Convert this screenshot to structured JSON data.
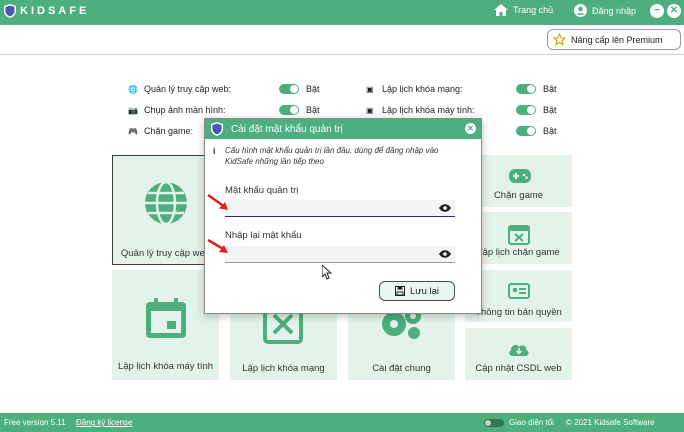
{
  "app": {
    "name": "KIDSAFE"
  },
  "header": {
    "home_label": "Trang chủ",
    "login_label": "Đăng nhập",
    "minimize": "−",
    "close": "✕"
  },
  "upgrade": {
    "label": "Nâng cấp lên Premium"
  },
  "settings_left": [
    {
      "label": "Quản lý truy cập web:",
      "state": "Bật",
      "icon": "globe-icon"
    },
    {
      "label": "Chụp ảnh màn hình:",
      "state": "Bật",
      "icon": "camera-icon"
    },
    {
      "label": "Chặn game:",
      "state": "Bật",
      "icon": "gamepad-icon"
    }
  ],
  "settings_right": [
    {
      "label": "Lập lịch khóa mạng:",
      "state": "Bật",
      "icon": "calendar-x-icon"
    },
    {
      "label": "Lập lịch khóa máy tính:",
      "state": "Bật",
      "icon": "calendar-x-icon"
    },
    {
      "label": "",
      "state": "Bật",
      "icon": "calendar-x-icon"
    }
  ],
  "cards": {
    "web": "Quản lý truy cập web",
    "game": "Chặn game",
    "schedule_game": "Lập lịch chặn game",
    "schedule_pc": "Lập lịch khóa máy tính",
    "schedule_net": "Lập lịch khóa mạng",
    "settings": "Cài đặt chung",
    "license": "Thông tin bản quyền",
    "update": "Cập nhật CSDL web"
  },
  "dialog": {
    "title": "Cài đặt mật khẩu quản trị",
    "info": "Cấu hình mật khẩu quản trị lần đầu, dùng để đăng nhập vào KidSafe những lần tiếp theo",
    "password_label": "Mật khẩu quản trị",
    "password_value": "",
    "confirm_label": "Nhập lại mật khẩu",
    "confirm_value": "",
    "save_label": "Lưu lại"
  },
  "footer": {
    "version": "Free version 5.11",
    "register": "Đăng ký license",
    "theme": "Giao diện tối",
    "copyright": "© 2021 Kidsafe Software"
  },
  "colors": {
    "accent": "#4caf7d",
    "card_bg": "#e3f3ea",
    "arrow": "#e02020"
  }
}
